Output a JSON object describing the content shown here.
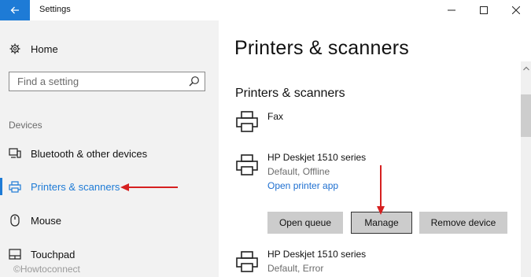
{
  "window": {
    "title": "Settings"
  },
  "sidebar": {
    "home_label": "Home",
    "search_placeholder": "Find a setting",
    "section_label": "Devices",
    "items": [
      {
        "label": "Bluetooth & other devices",
        "icon": "bluetooth-devices-icon"
      },
      {
        "label": "Printers & scanners",
        "icon": "printer-icon",
        "selected": true
      },
      {
        "label": "Mouse",
        "icon": "mouse-icon"
      },
      {
        "label": "Touchpad",
        "icon": "touchpad-icon"
      }
    ]
  },
  "watermark": "©Howtoconnect",
  "main": {
    "title": "Printers & scanners",
    "section_title": "Printers & scanners",
    "printers": [
      {
        "name": "Fax"
      },
      {
        "name": "HP Deskjet 1510 series",
        "status": "Default, Offline",
        "link": "Open printer app",
        "buttons": [
          "Open queue",
          "Manage",
          "Remove device"
        ]
      },
      {
        "name": "HP Deskjet 1510 series",
        "status": "Default, Error"
      }
    ]
  },
  "colors": {
    "accent": "#1e7bd6",
    "annotation_arrow": "#d62020",
    "sidebar_bg": "#f2f2f2",
    "button_bg": "#cccccc"
  }
}
